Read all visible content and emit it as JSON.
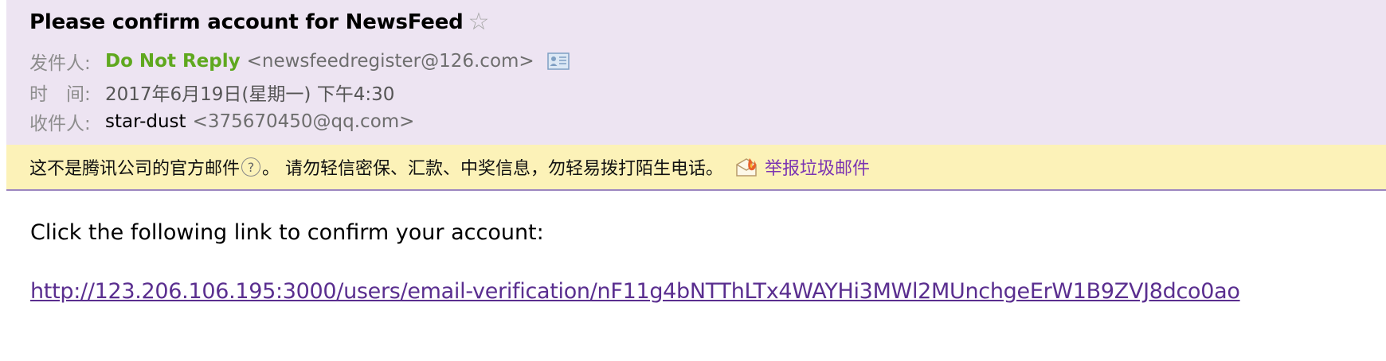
{
  "email": {
    "subject": "Please confirm account for NewsFeed",
    "star_glyph": "☆",
    "from": {
      "label": "发件人:",
      "name": "Do Not Reply",
      "address": "<newsfeedregister@126.com>"
    },
    "time": {
      "label": "时　间:",
      "value": "2017年6月19日(星期一) 下午4:30"
    },
    "to": {
      "label": "收件人:",
      "name": "star-dust",
      "address": "<375670450@qq.com>"
    }
  },
  "warning": {
    "text_before_help": "这不是腾讯公司的官方邮件",
    "help_glyph": "?",
    "text_after_help": "。 请勿轻信密保、汇款、中奖信息，勿轻易拨打陌生电话。",
    "report_label": "举报垃圾邮件"
  },
  "body": {
    "instruction": "Click the following link to confirm your account:",
    "link": "http://123.206.106.195:3000/users/email-verification/nF11g4bNTThLTx4WAYHi3MWl2MUnchgeErW1B9ZVJ8dco0ao"
  },
  "icons": {
    "star": "star-icon",
    "contact_card": "contact-card-icon",
    "help": "help-icon",
    "report": "report-spam-icon"
  },
  "colors": {
    "header_bg": "#ede4f2",
    "warning_bg": "#fcf2b8",
    "sender_green": "#5fa81f",
    "link_purple": "#5a2e8f",
    "report_purple": "#7b34b2"
  }
}
